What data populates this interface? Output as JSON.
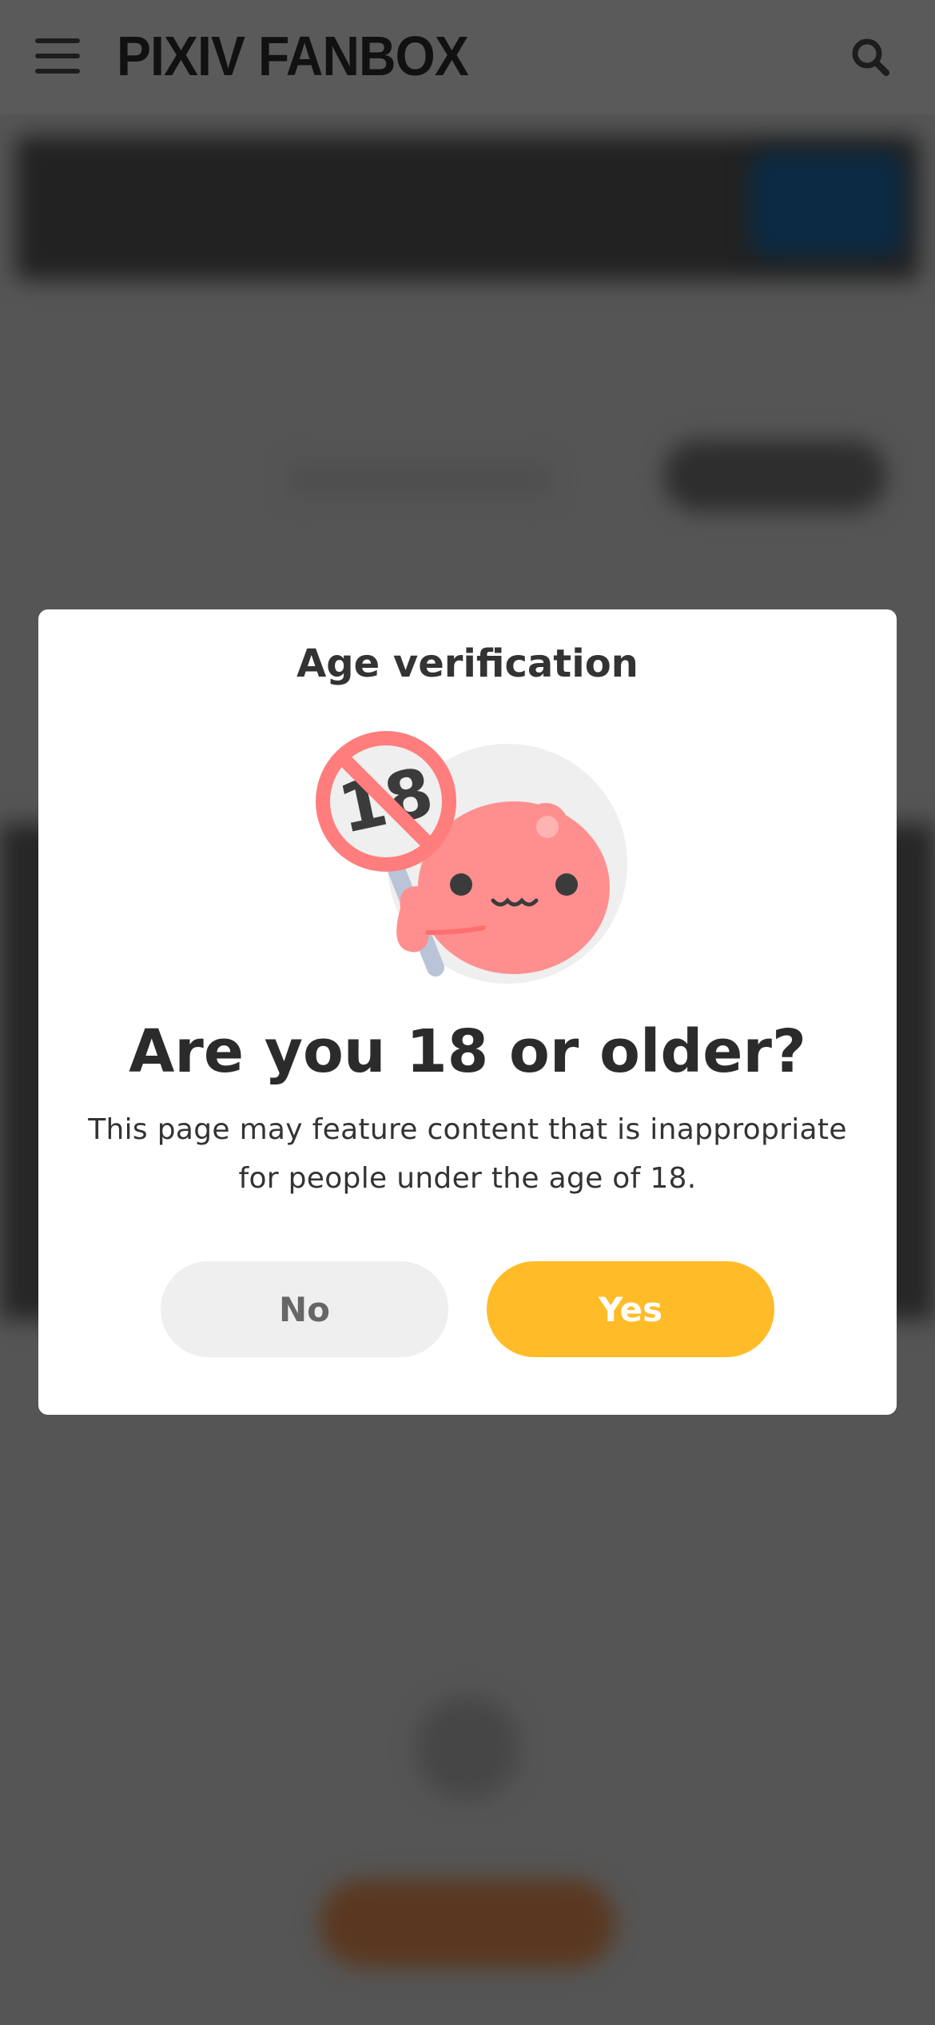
{
  "header": {
    "logo_text": "PIXIV FANBOX",
    "menu_icon": "hamburger-menu-icon",
    "search_icon": "search-icon"
  },
  "modal": {
    "title": "Age verification",
    "illustration_icon": "age-restriction-18-mascot-icon",
    "question": "Are you 18 or older?",
    "description": "This page may feature content that is inappropriate for people under the age of 18.",
    "no_label": "No",
    "yes_label": "Yes"
  },
  "colors": {
    "yes_button": "#ffbc28",
    "no_button": "#efefef",
    "overlay": "#555555",
    "mascot": "#ff8f8f"
  }
}
